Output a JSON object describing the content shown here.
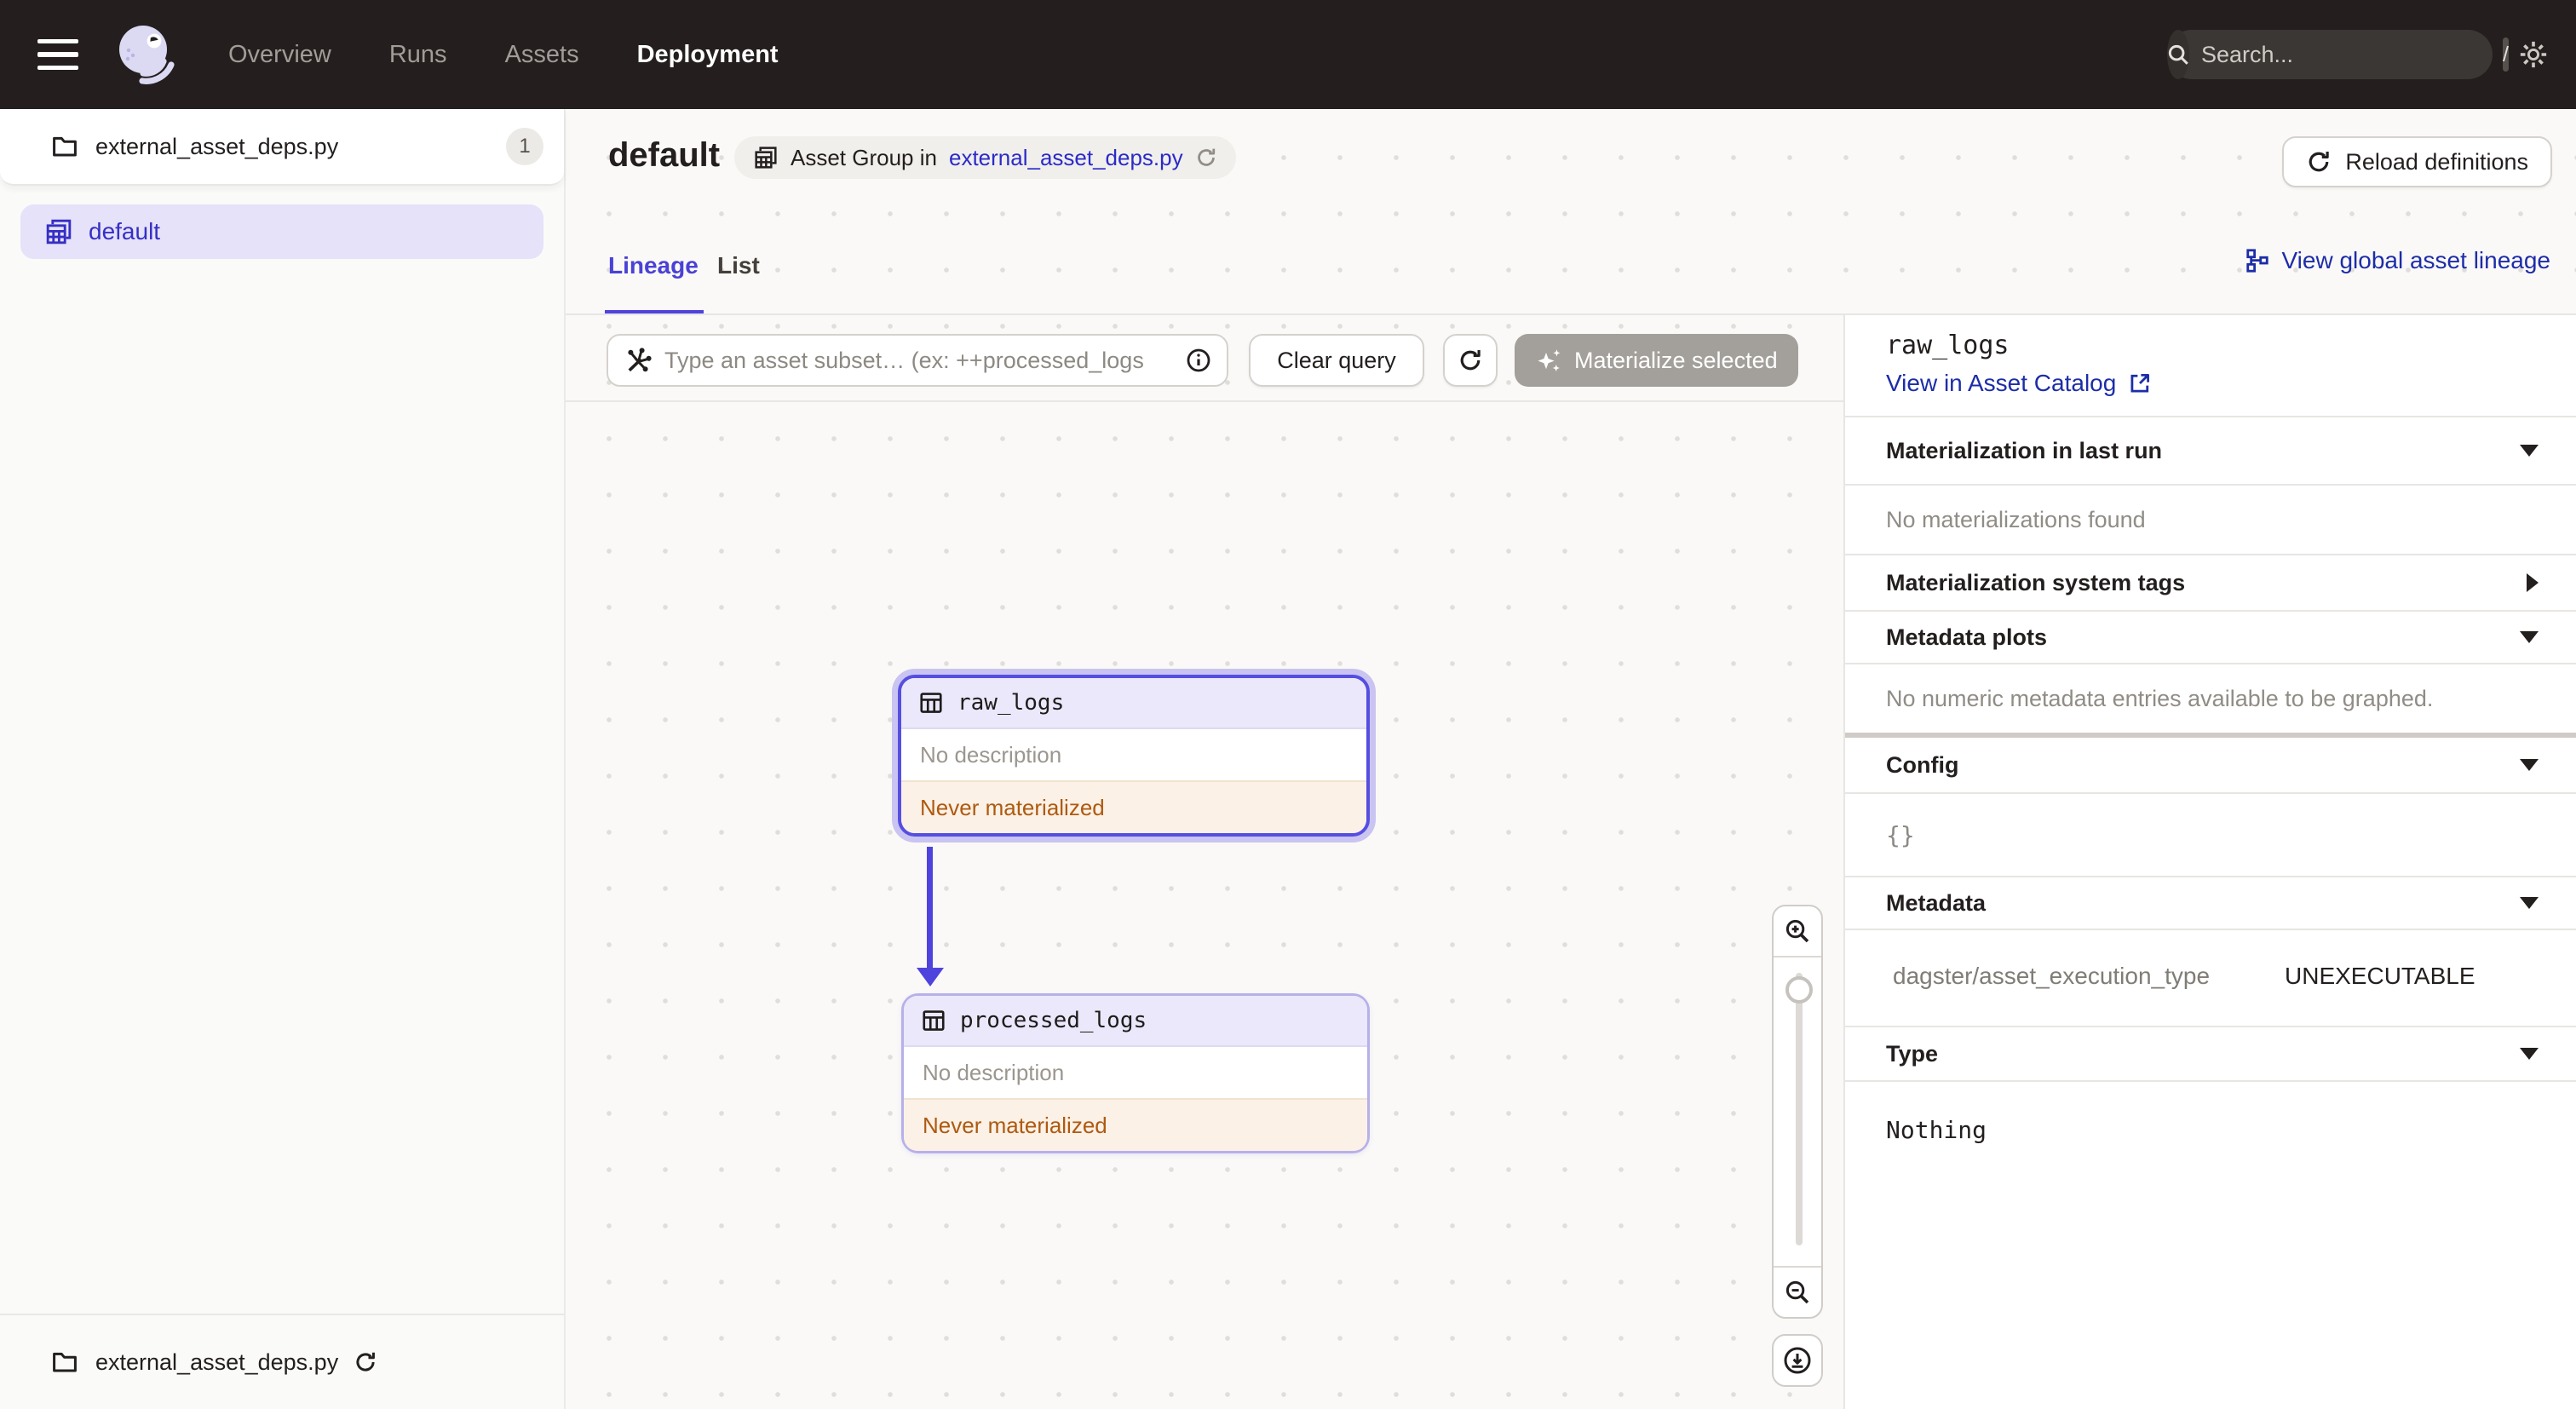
{
  "nav": {
    "items": [
      {
        "label": "Overview",
        "active": false
      },
      {
        "label": "Runs",
        "active": false
      },
      {
        "label": "Assets",
        "active": false
      },
      {
        "label": "Deployment",
        "active": true
      }
    ],
    "search_placeholder": "Search...",
    "search_shortcut": "/"
  },
  "sidebar": {
    "module_label": "external_asset_deps.py",
    "module_count": "1",
    "group_label": "default",
    "footer_label": "external_asset_deps.py"
  },
  "header": {
    "title": "default",
    "tag_prefix": "Asset Group in",
    "tag_link": "external_asset_deps.py",
    "reload_label": "Reload definitions"
  },
  "tabs": {
    "lineage": "Lineage",
    "list": "List",
    "global_link": "View global asset lineage"
  },
  "toolbar": {
    "query_placeholder": "Type an asset subset… (ex: ++processed_logs",
    "clear_label": "Clear query",
    "materialize_label": "Materialize selected"
  },
  "graph": {
    "nodes": [
      {
        "name": "raw_logs",
        "description": "No description",
        "status": "Never materialized",
        "selected": true
      },
      {
        "name": "processed_logs",
        "description": "No description",
        "status": "Never materialized",
        "selected": false
      }
    ]
  },
  "panel": {
    "title": "raw_logs",
    "catalog_link": "View in Asset Catalog",
    "last_run_label": "Materialization in last run",
    "last_run_empty": "No materializations found",
    "system_tags_label": "Materialization system tags",
    "metadata_plots_label": "Metadata plots",
    "metadata_plots_empty": "No numeric metadata entries available to be graphed.",
    "config_label": "Config",
    "config_value": "{}",
    "metadata_label": "Metadata",
    "metadata_rows": [
      {
        "key": "dagster/asset_execution_type",
        "value": "UNEXECUTABLE"
      }
    ],
    "type_label": "Type",
    "type_value": "Nothing"
  },
  "colors": {
    "accent": "#4F43DD",
    "selected_bg": "#E5E2F9",
    "link": "#1D2DA8",
    "warning_text": "#AE5A10",
    "warning_bg": "#FBF1E6",
    "nav_bg": "#241F1E"
  }
}
